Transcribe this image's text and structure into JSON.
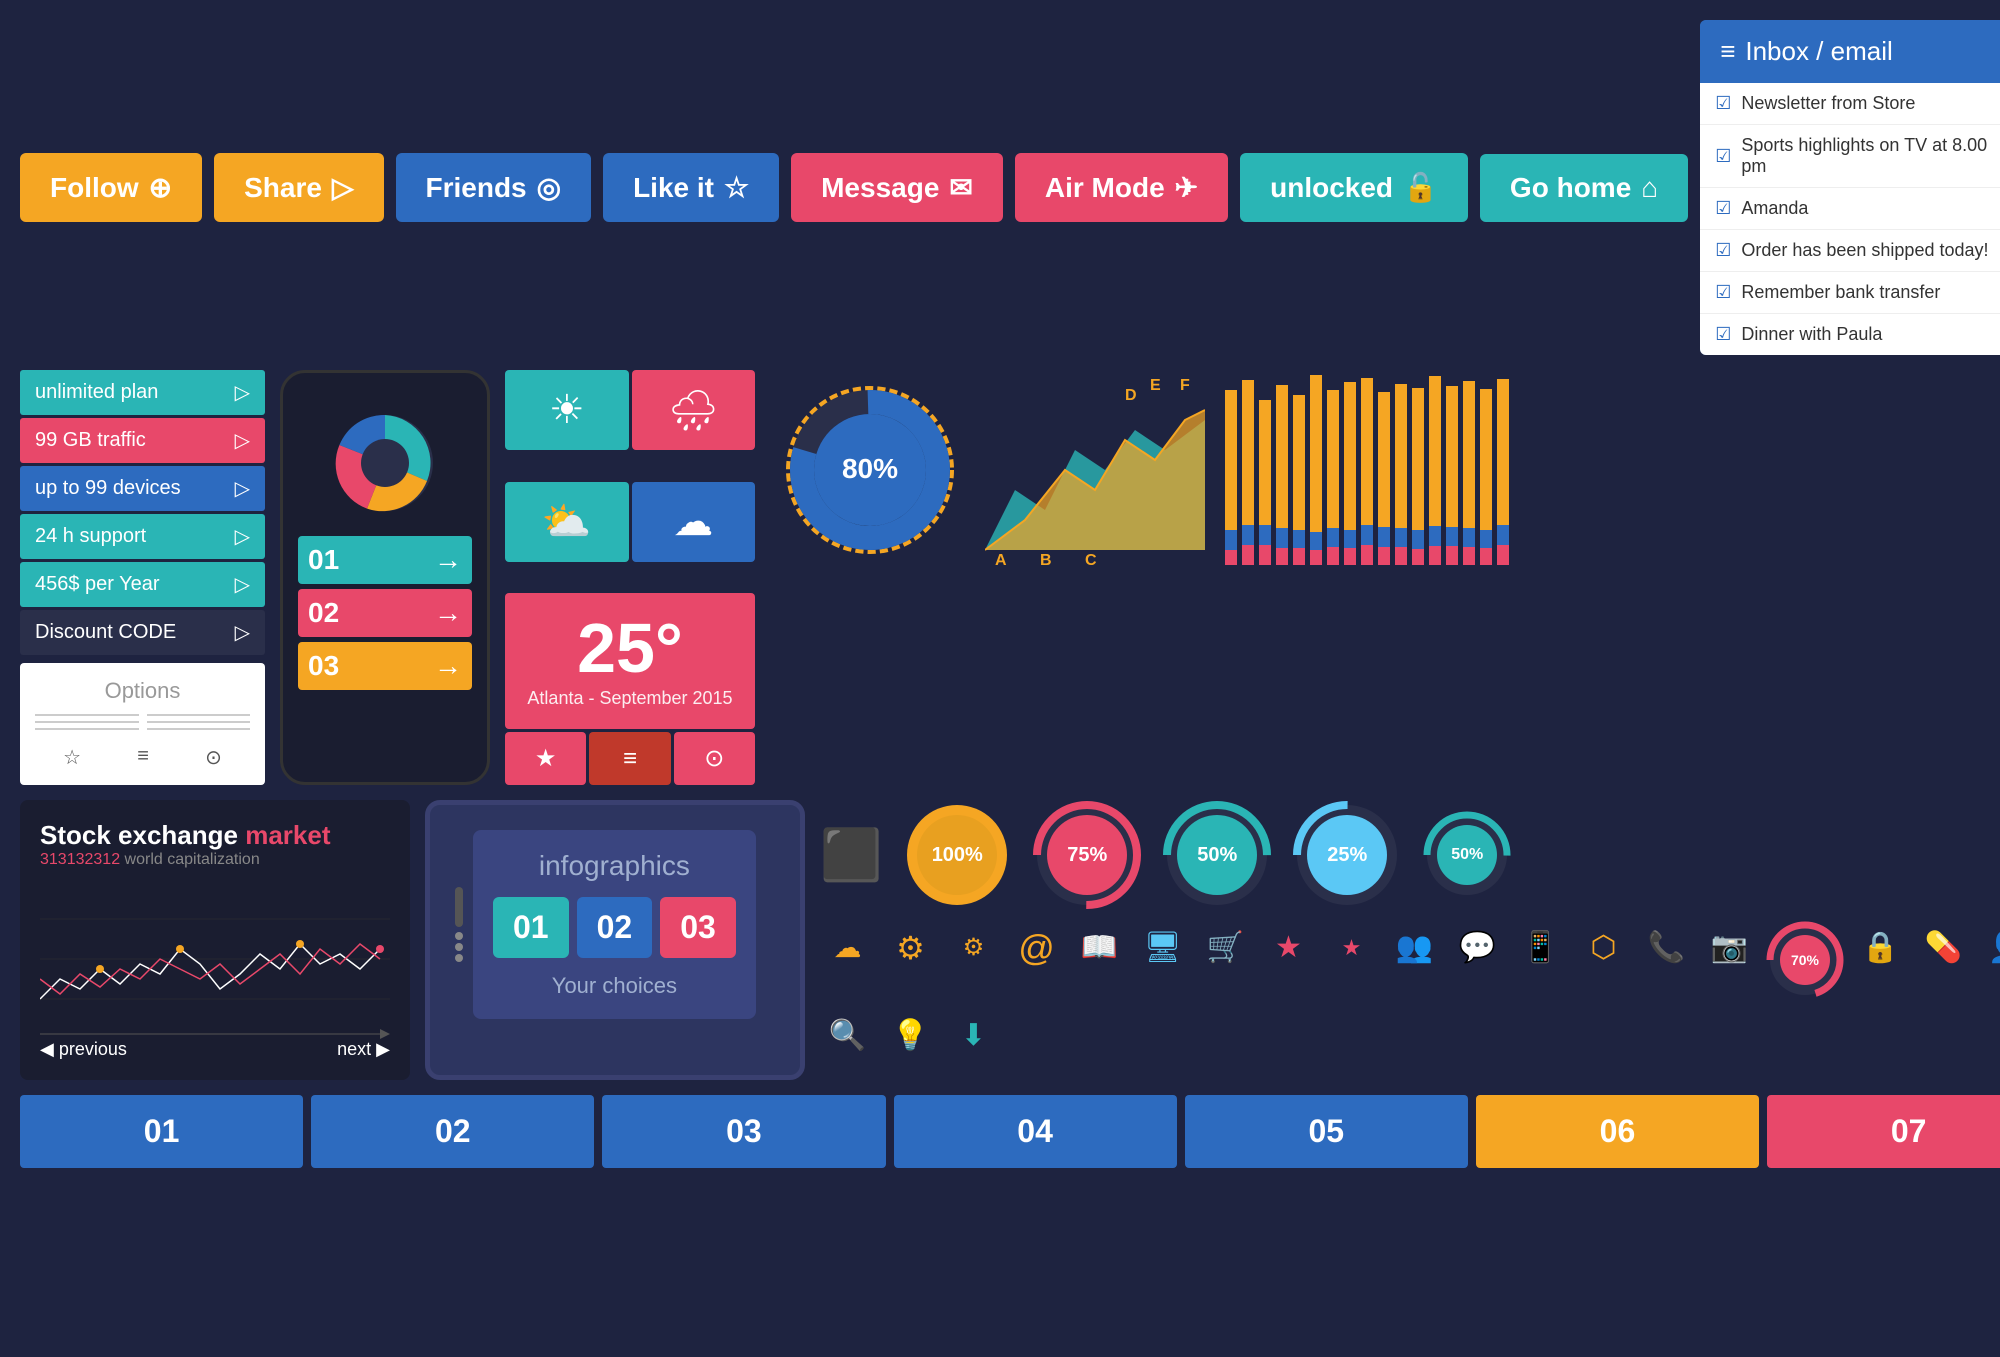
{
  "buttons": {
    "follow": "Follow",
    "share": "Share",
    "friends": "Friends",
    "like_it": "Like it",
    "message": "Message",
    "air_mode": "Air Mode",
    "unlocked": "unlocked",
    "go_home": "Go home"
  },
  "inbox": {
    "title": "Inbox / email",
    "items": [
      {
        "text": "Newsletter from Store",
        "star": "red"
      },
      {
        "text": "Sports highlights on TV at 8.00 pm",
        "star": "red"
      },
      {
        "text": "Amanda",
        "star": null
      },
      {
        "text": "Order has been shipped today!",
        "star": "yellow"
      },
      {
        "text": "Remember bank transfer",
        "star": null
      },
      {
        "text": "Dinner with Paula",
        "star": "red"
      }
    ]
  },
  "menu_items": [
    {
      "label": "unlimited plan",
      "color": "teal"
    },
    {
      "label": "99 GB traffic",
      "color": "pink"
    },
    {
      "label": "up to 99 devices",
      "color": "blue"
    },
    {
      "label": "24 h support",
      "color": "teal"
    },
    {
      "label": "456$ per Year",
      "color": "teal"
    },
    {
      "label": "Discount CODE",
      "color": "dark"
    }
  ],
  "options": {
    "title": "Options"
  },
  "phone": {
    "items": [
      "01",
      "02",
      "03"
    ]
  },
  "weather": {
    "temperature": "25°",
    "location": "Atlanta - September 2015"
  },
  "donut": {
    "percentage": "80%"
  },
  "area_labels": [
    "A",
    "B",
    "C",
    "D",
    "E",
    "F"
  ],
  "stock": {
    "title": "Stock exchange",
    "title_accent": "market",
    "subtitle": "313132312",
    "subtitle_rest": " world capitalization",
    "prev": "previous",
    "next": "next"
  },
  "tablet": {
    "title": "infographics",
    "numbers": [
      "01",
      "02",
      "03"
    ],
    "choices": "Your choices"
  },
  "circles": {
    "items": [
      {
        "label": "100%",
        "color": "#f5a623",
        "pct": 100
      },
      {
        "label": "75%",
        "color": "#e8486a",
        "pct": 75
      },
      {
        "label": "50%",
        "color": "#2ab5b5",
        "pct": 50
      },
      {
        "label": "25%",
        "color": "#5bc8f5",
        "pct": 25
      }
    ],
    "small": [
      {
        "label": "50%",
        "color": "#2ab5b5",
        "pct": 50
      },
      {
        "label": "70%",
        "color": "#e8486a",
        "pct": 70
      }
    ]
  },
  "num_tabs": [
    "01",
    "02",
    "03",
    "04",
    "05",
    "06",
    "07"
  ],
  "colors": {
    "bg": "#1e2340",
    "teal": "#2ab5b5",
    "pink": "#e8486a",
    "blue": "#2d6bbf",
    "orange": "#f5a623"
  }
}
